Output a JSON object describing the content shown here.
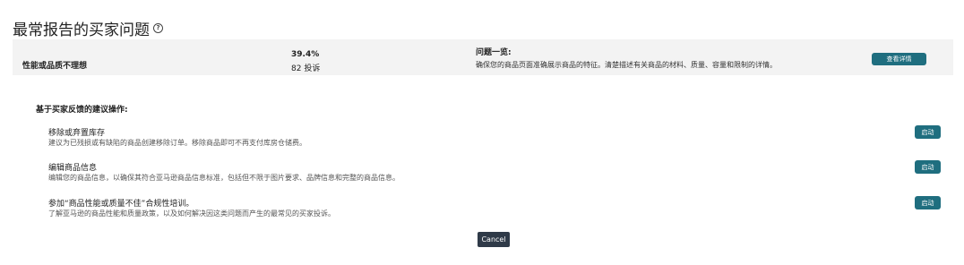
{
  "page": {
    "title": "最常报告的买家问题",
    "help_icon": "?"
  },
  "summary": {
    "category": "性能或品质不理想",
    "percent": "39.4%",
    "complaints": "82 投诉",
    "issue_heading": "问题一览:",
    "issue_text": "确保您的商品页面准确展示商品的特征。清楚描述有关商品的材料、质量、容量和限制的详情。",
    "details_button": "查看详情"
  },
  "recommendations": {
    "heading": "基于买家反馈的建议操作:",
    "items": [
      {
        "title": "移除或弃置库存",
        "description": "建议为已残损或有缺陷的商品创建移除订单。移除商品即可不再支付库房仓储费。",
        "button": "启动"
      },
      {
        "title": "编辑商品信息",
        "description": "编辑您的商品信息，以确保其符合亚马逊商品信息标准，包括但不限于图片要求、品牌信息和完整的商品信息。",
        "button": "启动"
      },
      {
        "title": "参加“商品性能或质量不佳”合规性培训。",
        "description": "了解亚马逊的商品性能和质量政策，以及如何解决因这类问题而产生的最常见的买家投诉。",
        "button": "启动"
      }
    ]
  },
  "footer": {
    "cancel_button": "Cancel"
  },
  "colors": {
    "accent": "#1f6e7f",
    "cancel": "#2f3a48",
    "summary_bg": "#f3f3f3"
  }
}
